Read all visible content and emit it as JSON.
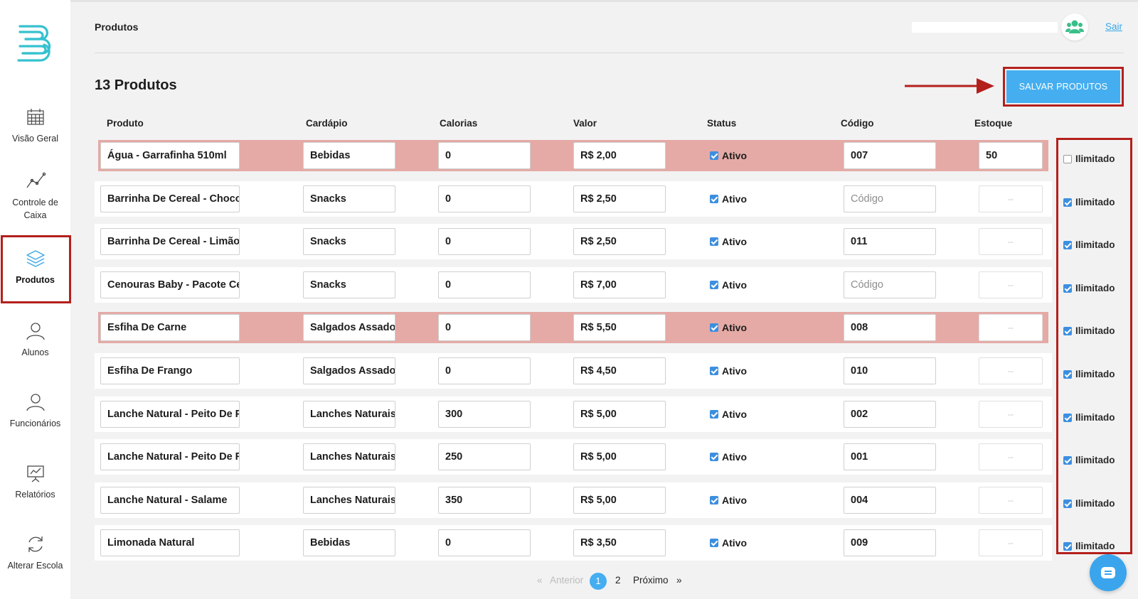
{
  "header": {
    "title": "Produtos",
    "logout": "Sair"
  },
  "sidebar": {
    "items": [
      {
        "label": "Visão Geral",
        "icon": "calendar-icon"
      },
      {
        "label": "Controle de Caixa",
        "icon": "line-chart-icon"
      },
      {
        "label": "Produtos",
        "icon": "layers-icon",
        "active": true
      },
      {
        "label": "Alunos",
        "icon": "user-icon"
      },
      {
        "label": "Funcionários",
        "icon": "user-icon"
      },
      {
        "label": "Relatórios",
        "icon": "presentation-icon"
      },
      {
        "label": "Alterar Escola",
        "icon": "refresh-icon"
      }
    ]
  },
  "main": {
    "count_title": "13 Produtos",
    "save_button": "SALVAR PRODUTOS",
    "columns": [
      "Produto",
      "Cardápio",
      "Calorias",
      "Valor",
      "Status",
      "Código",
      "Estoque"
    ],
    "code_placeholder": "Código",
    "stock_disabled": "--",
    "status_label": "Ativo",
    "unlimited_label": "Ilimitado",
    "rows": [
      {
        "produto": "Água - Garrafinha 510ml",
        "cardapio": "Bebidas",
        "calorias": "0",
        "valor": "R$ 2,00",
        "codigo": "007",
        "estoque": "50",
        "ilimitado": false,
        "highlight": true
      },
      {
        "produto": "Barrinha De Cereal - Chocolate",
        "cardapio": "Snacks",
        "calorias": "0",
        "valor": "R$ 2,50",
        "codigo": "",
        "estoque": "",
        "ilimitado": true,
        "highlight": false
      },
      {
        "produto": "Barrinha De Cereal - Limão",
        "cardapio": "Snacks",
        "calorias": "0",
        "valor": "R$ 2,50",
        "codigo": "011",
        "estoque": "",
        "ilimitado": true,
        "highlight": false
      },
      {
        "produto": "Cenouras Baby - Pacote Cenoura",
        "cardapio": "Snacks",
        "calorias": "0",
        "valor": "R$ 7,00",
        "codigo": "",
        "estoque": "",
        "ilimitado": true,
        "highlight": false
      },
      {
        "produto": "Esfiha De Carne",
        "cardapio": "Salgados Assados",
        "calorias": "0",
        "valor": "R$ 5,50",
        "codigo": "008",
        "estoque": "",
        "ilimitado": true,
        "highlight": true
      },
      {
        "produto": "Esfiha De Frango",
        "cardapio": "Salgados Assados",
        "calorias": "0",
        "valor": "R$ 4,50",
        "codigo": "010",
        "estoque": "",
        "ilimitado": true,
        "highlight": false
      },
      {
        "produto": "Lanche Natural - Peito De Peru",
        "cardapio": "Lanches Naturais",
        "calorias": "300",
        "valor": "R$ 5,00",
        "codigo": "002",
        "estoque": "",
        "ilimitado": true,
        "highlight": false
      },
      {
        "produto": "Lanche Natural - Peito De Frango",
        "cardapio": "Lanches Naturais",
        "calorias": "250",
        "valor": "R$ 5,00",
        "codigo": "001",
        "estoque": "",
        "ilimitado": true,
        "highlight": false
      },
      {
        "produto": "Lanche Natural - Salame",
        "cardapio": "Lanches Naturais",
        "calorias": "350",
        "valor": "R$ 5,00",
        "codigo": "004",
        "estoque": "",
        "ilimitado": true,
        "highlight": false
      },
      {
        "produto": "Limonada Natural",
        "cardapio": "Bebidas",
        "calorias": "0",
        "valor": "R$ 3,50",
        "codigo": "009",
        "estoque": "",
        "ilimitado": true,
        "highlight": false
      }
    ]
  },
  "pagination": {
    "prev_arrow": "«",
    "prev": "Anterior",
    "pages": [
      "1",
      "2"
    ],
    "current": "1",
    "next": "Próximo",
    "next_arrow": "»"
  },
  "colors": {
    "accent": "#45aef0",
    "annotation_red": "#b3201c",
    "row_highlight": "#e5aaa5"
  }
}
